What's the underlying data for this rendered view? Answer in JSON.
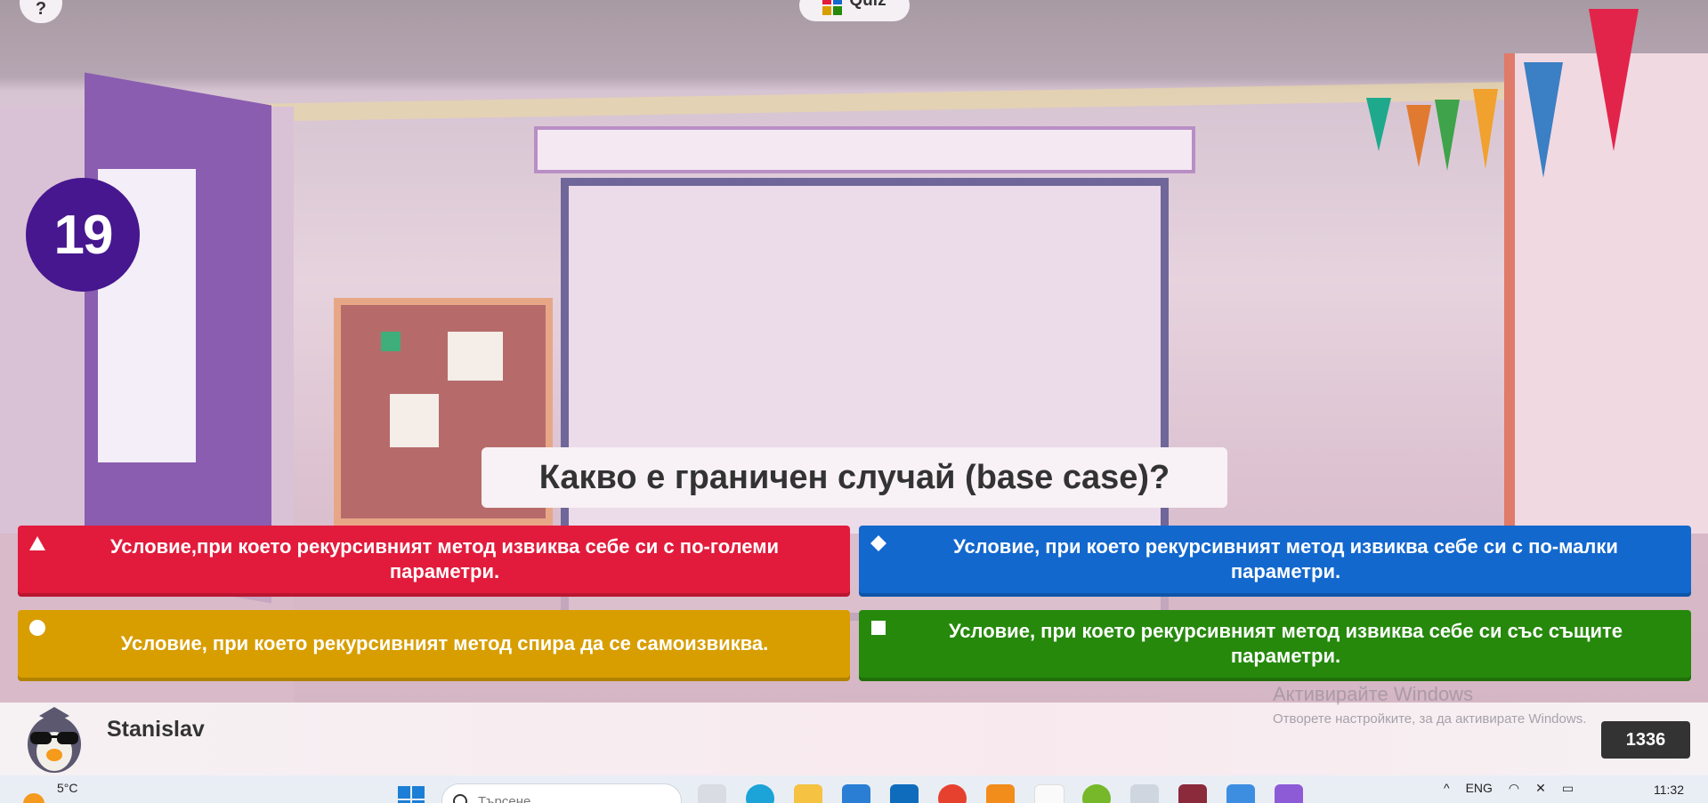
{
  "header": {
    "corner_button_label": "?",
    "app_pill_label": "Quiz"
  },
  "question": {
    "number": "19",
    "text": "Какво е граничен случай (base case)?"
  },
  "answers": [
    {
      "text": "Условие,при което рекурсивният метод извиква себе си с по-големи параметри.",
      "shape": "triangle",
      "color": "#e21b3c"
    },
    {
      "text": "Условие, при което рекурсивният метод извиква себе си с по-малки параметри.",
      "shape": "diamond",
      "color": "#1368ce"
    },
    {
      "text": "Условие, при което рекурсивният метод спира да се самоизвиква.",
      "shape": "circle",
      "color": "#d89e00"
    },
    {
      "text": "Условие, при което рекурсивният метод извиква себе си със същите параметри.",
      "shape": "square",
      "color": "#26890c"
    }
  ],
  "player": {
    "name": "Stanislav",
    "score": "1336",
    "avatar_icon": "penguin-sunglasses-icon"
  },
  "windows_watermark": {
    "title": "Активирайте Windows",
    "subtitle": "Отворете настройките, за да активирате Windows."
  },
  "taskbar": {
    "temperature": "5°C",
    "search_placeholder": "Търсене",
    "language": "ENG",
    "time": "11:32",
    "apps": [
      "task-view-icon",
      "edge-icon",
      "file-explorer-icon",
      "store-icon",
      "outlook-icon",
      "chrome-icon",
      "app-icon",
      "app-icon-2",
      "utorrent-icon",
      "chrome-profile-icon",
      "winrar-icon",
      "notepad-icon",
      "visual-studio-icon"
    ]
  }
}
